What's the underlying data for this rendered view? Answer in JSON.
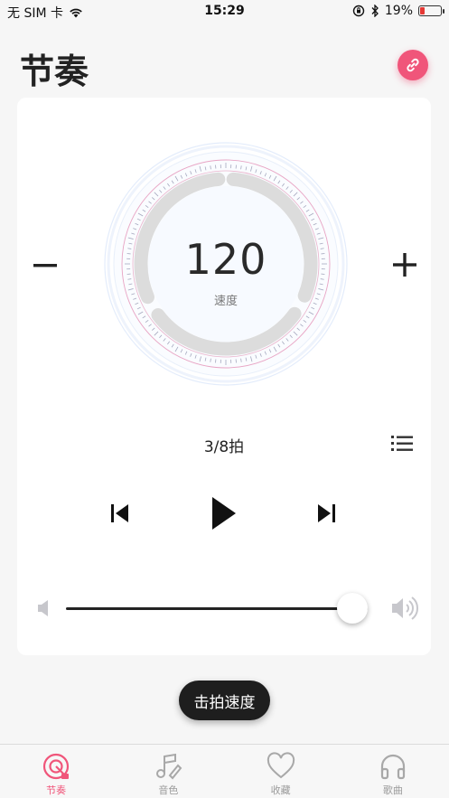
{
  "status_bar": {
    "carrier": "无 SIM 卡",
    "time": "15:29",
    "battery_percent": "19%",
    "battery_level": 0.19
  },
  "header": {
    "title": "节奏",
    "link_icon": "link-icon"
  },
  "metronome": {
    "tempo": "120",
    "tempo_label": "速度",
    "minus_label": "−",
    "plus_label": "+",
    "beat": "3/8拍",
    "volume_level": 1.0
  },
  "tap_button": "击拍速度",
  "tabs": [
    {
      "label": "节奏",
      "icon": "rhythm-icon",
      "active": true
    },
    {
      "label": "音色",
      "icon": "music-note-icon",
      "active": false
    },
    {
      "label": "收藏",
      "icon": "heart-icon",
      "active": false
    },
    {
      "label": "歌曲",
      "icon": "headphones-icon",
      "active": false
    }
  ],
  "colors": {
    "accent": "#f0557a",
    "dark": "#1e1e1e"
  }
}
